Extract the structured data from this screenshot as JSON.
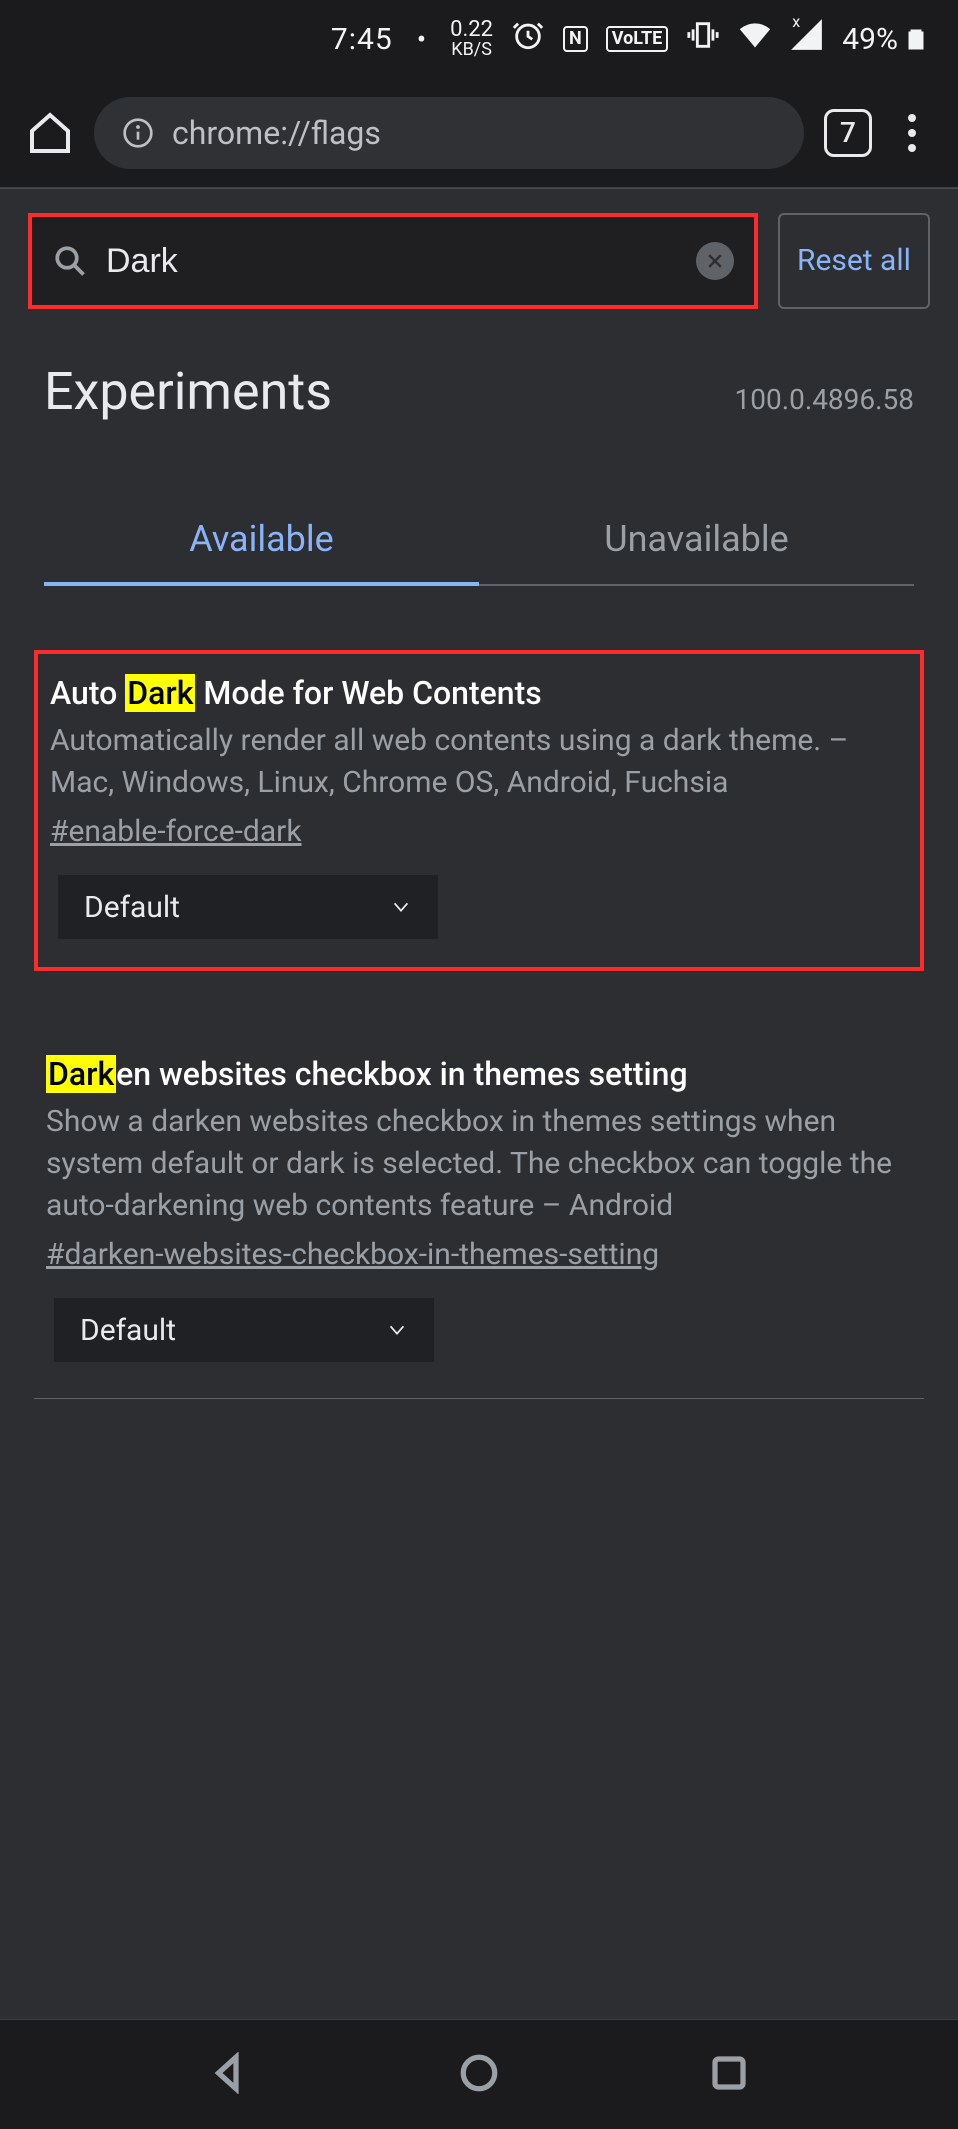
{
  "status_bar": {
    "time": "7:45",
    "net_rate_value": "0.22",
    "net_rate_unit": "KB/S",
    "lte_badge": "LTE",
    "nfc_badge": "N",
    "battery_pct": "49%"
  },
  "browser_bar": {
    "url": "chrome://flags",
    "tab_count": "7"
  },
  "flags_page": {
    "search_value": "Dark",
    "reset_label": "Reset all",
    "title": "Experiments",
    "version": "100.0.4896.58",
    "tabs": {
      "available": "Available",
      "unavailable": "Unavailable"
    },
    "items": [
      {
        "title_pre": "Auto ",
        "title_hl": "Dark",
        "title_post": " Mode for Web Contents",
        "desc": "Automatically render all web contents using a dark theme. – Mac, Windows, Linux, Chrome OS, Android, Fuchsia",
        "hash": "#enable-force-dark",
        "select": "Default"
      },
      {
        "title_pre": "",
        "title_hl": "Dark",
        "title_post": "en websites checkbox in themes setting",
        "desc": "Show a darken websites checkbox in themes settings when system default or dark is selected. The checkbox can toggle the auto-darkening web contents feature – Android",
        "hash": "#darken-websites-checkbox-in-themes-setting",
        "select": "Default"
      }
    ]
  }
}
